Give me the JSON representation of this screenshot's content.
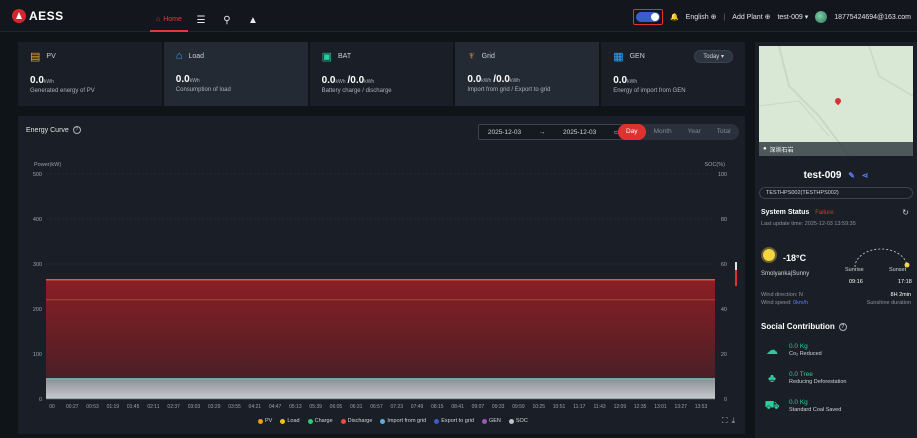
{
  "topbar": {
    "logo_text": "AESS",
    "nav_home": "Home",
    "language": "English",
    "add_plant": "Add Plant",
    "plant_selector": "test-009",
    "account": "18775424694@163.com"
  },
  "cards": [
    {
      "name": "PV",
      "value": "0.0",
      "unit": "kWh",
      "desc": "Generated energy of PV"
    },
    {
      "name": "Load",
      "value": "0.0",
      "unit": "kWh",
      "desc": "Consumption of load"
    },
    {
      "name": "BAT",
      "value1": "0.0",
      "unit1": "kWh",
      "value2": "0.0",
      "unit2": "kWh",
      "desc": "Battery charge / discharge"
    },
    {
      "name": "Grid",
      "value1": "0.0",
      "unit1": "kWh",
      "value2": "0.0",
      "unit2": "kWh",
      "desc": "Import from grid / Export to grid"
    },
    {
      "name": "GEN",
      "value": "0.0",
      "unit": "kWh",
      "desc": "Energy of import from GEN"
    }
  ],
  "today_button": "Today",
  "curve": {
    "title": "Energy Curve",
    "date_start": "2025-12-03",
    "date_end": "2025-12-03",
    "date_sep": "→",
    "tabs": [
      "Day",
      "Month",
      "Year",
      "Total"
    ],
    "selected_tab": "Day",
    "legend": [
      {
        "name": "PV",
        "color": "#f39c12"
      },
      {
        "name": "Load",
        "color": "#f1c40f"
      },
      {
        "name": "Charge",
        "color": "#2ecc71"
      },
      {
        "name": "Discharge",
        "color": "#e74c3c"
      },
      {
        "name": "Import from grid",
        "color": "#5dade2"
      },
      {
        "name": "Export to grid",
        "color": "#3b5ccc"
      },
      {
        "name": "GEN",
        "color": "#9b59b6"
      },
      {
        "name": "SOC",
        "color": "#bdc3c7"
      }
    ]
  },
  "chart_data": {
    "type": "area",
    "yleft_label": "Power(kW)",
    "yright_label": "SOC(%)",
    "yleft_ticks": [
      0,
      100,
      200,
      300,
      400,
      500
    ],
    "yright_ticks": [
      0,
      20,
      40,
      60,
      80,
      100
    ],
    "ylim_left": [
      0,
      500
    ],
    "ylim_right": [
      0,
      100
    ],
    "x_ticks": [
      "00",
      "00:27",
      "00:53",
      "01:19",
      "01:45",
      "02:11",
      "02:37",
      "03:03",
      "03:29",
      "03:55",
      "04:21",
      "04:47",
      "05:13",
      "05:39",
      "06:05",
      "06:31",
      "06:57",
      "07:23",
      "07:49",
      "08:15",
      "08:41",
      "09:07",
      "09:33",
      "09:59",
      "10:25",
      "10:51",
      "11:17",
      "11:43",
      "12:09",
      "12:35",
      "13:01",
      "13:27",
      "13:53"
    ],
    "series": [
      {
        "name": "PV",
        "value": 0
      },
      {
        "name": "Load",
        "value": 0
      },
      {
        "name": "Charge",
        "value": 0
      },
      {
        "name": "Discharge",
        "value": 265
      },
      {
        "name": "Import from grid",
        "value": 0
      },
      {
        "name": "Export to grid",
        "value": 0
      },
      {
        "name": "GEN",
        "value": 0
      },
      {
        "name": "SOC",
        "value": 55
      }
    ],
    "soc_band_value": 45,
    "discharge_line": 265,
    "grid": true,
    "legend_position": "bottom"
  },
  "right_panel": {
    "map_label": "深圳石岩",
    "plant_name": "test-009",
    "sn": "TESTHPS002(TESTHPS002)",
    "system_status_label": "System Status",
    "status_value": "Failure",
    "last_update": "Last update time: 2025-12-03 13:59:35",
    "temperature": "-18°C",
    "location_weather": "Smolyanka|Sunny",
    "sunrise_label": "Sunrise",
    "sunset_label": "Sunset",
    "sunrise_time": "09:16",
    "sunset_time": "17:18",
    "wind_direction": "Wind direction: N",
    "wind_speed_label": "Wind speed:",
    "wind_speed_value": "0km/h",
    "sunshine_value": "8H 2min",
    "sunshine_label": "Sunshine duration",
    "social_title": "Social Contribution",
    "social": [
      {
        "value": "0.0 Kg",
        "label": "Co₂ Reduced",
        "icon": "cloud-icon"
      },
      {
        "value": "0.0 Tree",
        "label": "Reducing Deforestation",
        "icon": "tree-icon"
      },
      {
        "value": "0.0 Kg",
        "label": "Standard Coal Saved",
        "icon": "coal-cart-icon"
      }
    ]
  }
}
